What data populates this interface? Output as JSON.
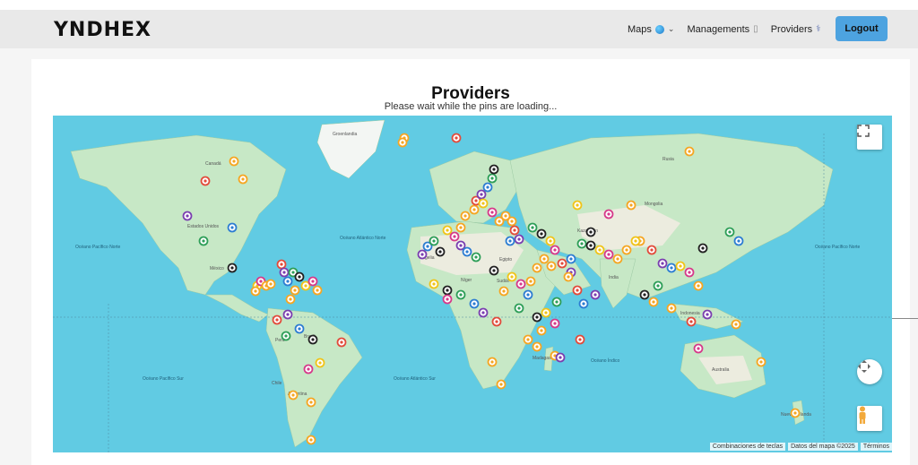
{
  "brand": {
    "logo_text": "YNDHEX"
  },
  "nav": {
    "maps_label": "Maps",
    "managements_label": "Managements",
    "providers_label": "Providers",
    "logout_label": "Logout"
  },
  "page": {
    "title": "Providers",
    "subtitle": "Please wait while the pins are loading..."
  },
  "map": {
    "attribution": [
      "Combinaciones de teclas",
      "Datos del mapa ©2025",
      "Términos"
    ],
    "labels": {
      "greenland": "Groenlandia",
      "canada": "Canadá",
      "north_pacific": "Océano Pacífico Norte",
      "north_atlantic": "Océano Atlántico Norte",
      "south_pacific": "Océano Pacífico Sur",
      "south_atlantic": "Océano Atlántico Sur",
      "indian": "Océano Índico",
      "brazil": "Brasil",
      "peru": "Perú",
      "argentina": "Argentina",
      "mongolia": "Mongolia",
      "kazakhstan": "Kazajistán",
      "india": "India",
      "russia": "Rusia",
      "algeria": "Argelia",
      "egypt": "Egipto",
      "niger": "Níger",
      "sudan": "Sudán",
      "australia": "Australia",
      "indonesia": "Indonesia",
      "madagascar": "Madagascar",
      "chile": "Chile",
      "nueva_zelanda": "Nueva Zelanda",
      "mexico": "México",
      "usa": "Estados Unidos"
    }
  },
  "colors": {
    "ocean": "#61cbe3",
    "land": "#bfe5c4",
    "logout": "#4da3e0"
  }
}
